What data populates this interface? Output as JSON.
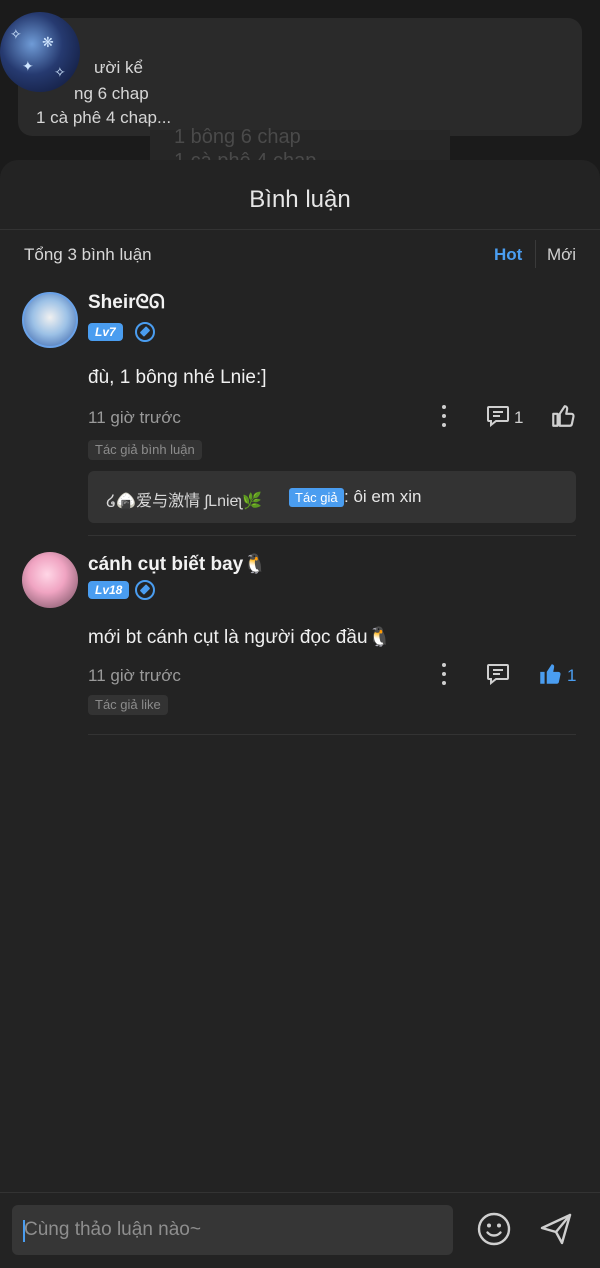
{
  "background": {
    "line1": "ười kể",
    "line2": "ng 6 chap",
    "line3": "1 cà phê 4 chap...",
    "ghost1": "1 bông 6 chap",
    "ghost2": "1 cà phê 4 chap"
  },
  "sheet": {
    "title": "Bình luận",
    "count_label": "Tổng 3 bình luận",
    "sort_hot": "Hot",
    "sort_new": "Mới"
  },
  "comments": [
    {
      "username": "Sheirᘓᘏ",
      "level": "Lv7",
      "text": "đù, 1 bông nhé Lnie:]",
      "time": "11 giờ trước",
      "reply_count": "1",
      "tag": "Tác giả bình luận",
      "reply": {
        "user": "໒🍙爱与激情 ʃLnieʅ🌿",
        "author_tag": "Tác giả",
        "text": ": ôi em xin"
      }
    },
    {
      "username": "cánh cụt biết bay🐧",
      "level": "Lv18",
      "text": "mới bt cánh cụt là người đọc đầu🐧",
      "time": "11 giờ trước",
      "like_count": "1",
      "tag": "Tác giả like"
    }
  ],
  "composer": {
    "placeholder": "Cùng thảo luận nào~"
  },
  "colors": {
    "accent": "#4a9df0",
    "sheet": "#232323"
  }
}
